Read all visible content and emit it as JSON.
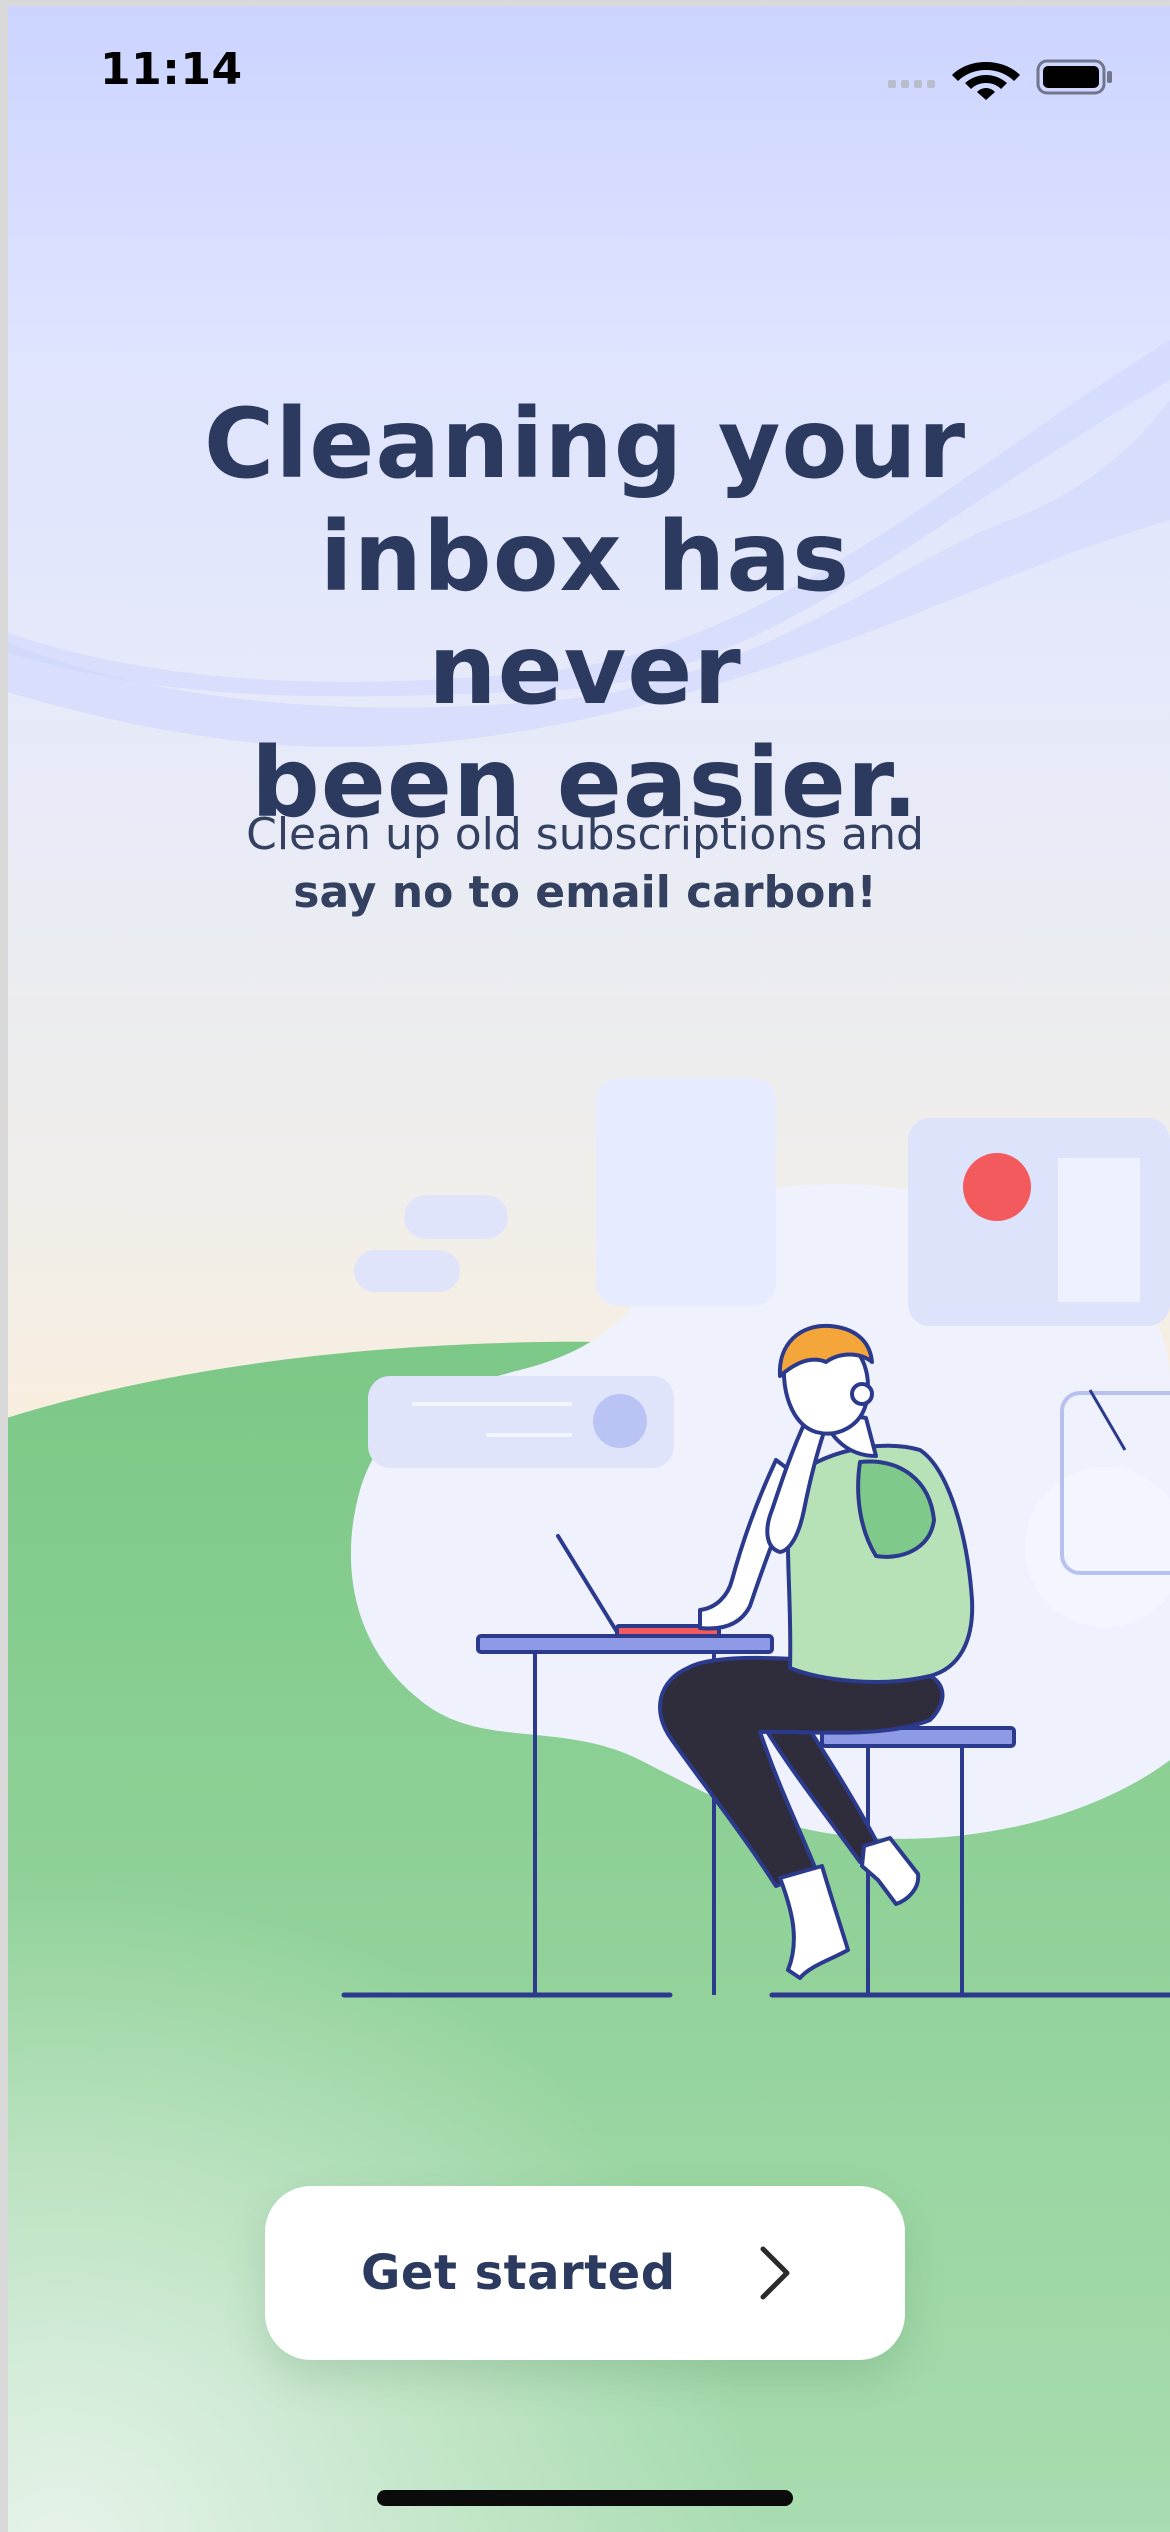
{
  "status_bar": {
    "time": "11:14",
    "icons": [
      "cellular-signal-icon",
      "wifi-icon",
      "battery-icon"
    ]
  },
  "onboarding": {
    "headline_lines": [
      "Cleaning your",
      "inbox has never",
      "been easier."
    ],
    "subtitle_plain": "Clean up old subscriptions and",
    "subtitle_bold": "say no to email carbon!",
    "illustration": "person-working-at-laptop-illustration"
  },
  "cta": {
    "label": "Get started",
    "icon": "chevron-right-icon"
  },
  "colors": {
    "heading": "#2b3a5e",
    "accent_green": "#7fca8a",
    "accent_lavender": "#dfe4ff",
    "accent_red": "#f25a5e",
    "line_navy": "#2b3a8c"
  }
}
